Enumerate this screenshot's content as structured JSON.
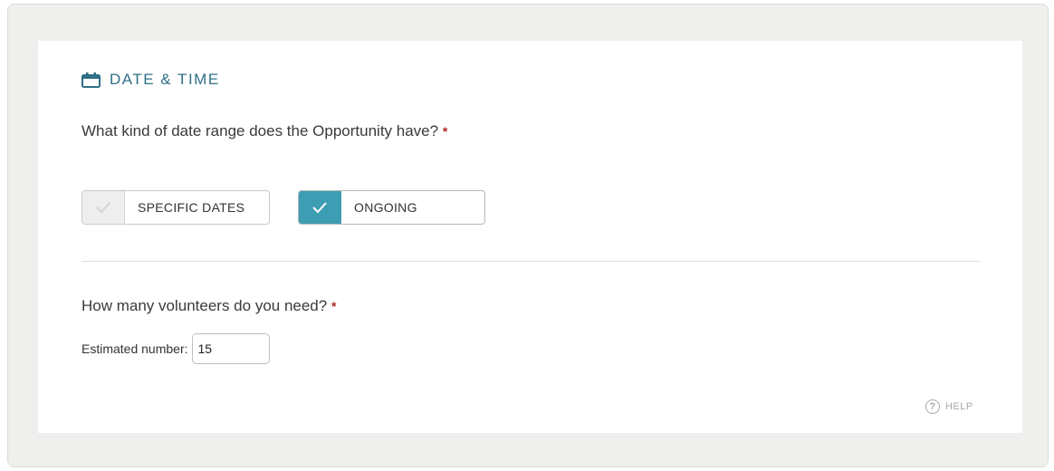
{
  "section": {
    "title": "DATE & TIME",
    "icon": "calendar-icon",
    "accent_color": "#2f6f86"
  },
  "date_range": {
    "question": "What kind of date range does the Opportunity have?",
    "required_mark": "*",
    "options": [
      {
        "label": "SPECIFIC DATES",
        "selected": false
      },
      {
        "label": "ONGOING",
        "selected": true
      }
    ],
    "selected_color": "#3d9db2"
  },
  "volunteers": {
    "question": "How many volunteers do you need?",
    "required_mark": "*",
    "estimate_label": "Estimated number:",
    "estimate_value": "15"
  },
  "help": {
    "icon": "question-circle-icon",
    "label": "HELP"
  }
}
